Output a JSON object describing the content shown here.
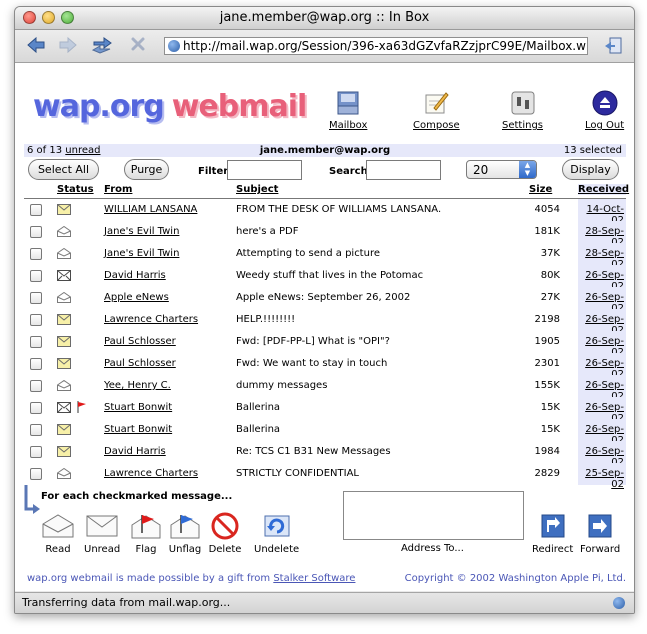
{
  "window": {
    "title": "jane.member@wap.org :: In Box"
  },
  "toolbar": {
    "url": "http://mail.wap.org/Session/396-xa63dGZvfaRZzjprC99E/Mailbox.w"
  },
  "brand": {
    "part1": "wap.org",
    "part2": "webmail"
  },
  "nav": [
    {
      "label": "Mailbox",
      "icon": "mailbox-icon"
    },
    {
      "label": "Compose",
      "icon": "compose-icon"
    },
    {
      "label": "Settings",
      "icon": "settings-icon"
    },
    {
      "label": "Log Out",
      "icon": "logout-icon"
    }
  ],
  "info": {
    "count_prefix": "6 of 13",
    "unread_link": "unread",
    "account": "jane.member@wap.org",
    "selected": "13 selected"
  },
  "controls": {
    "select_all": "Select All",
    "purge": "Purge",
    "filter_label": "Filter:",
    "search_label": "Search:",
    "page_size": "20",
    "display": "Display"
  },
  "columns": {
    "status": "Status",
    "from": "From",
    "subject": "Subject",
    "size": "Size",
    "received": "Received"
  },
  "messages": [
    {
      "status": "new",
      "flagged": false,
      "from": "WILLIAM LANSANA",
      "subject": "FROM THE DESK OF WILLIAMS LANSANA.",
      "size": "4054",
      "date": "14-Oct-02"
    },
    {
      "status": "read",
      "flagged": false,
      "from": "Jane's Evil Twin",
      "subject": "here's a PDF",
      "size": "181K",
      "date": "28-Sep-02"
    },
    {
      "status": "read",
      "flagged": false,
      "from": "Jane's Evil Twin",
      "subject": "Attempting to send a picture",
      "size": "37K",
      "date": "28-Sep-02"
    },
    {
      "status": "replied",
      "flagged": false,
      "from": "David Harris",
      "subject": "Weedy stuff that lives in the Potomac",
      "size": "80K",
      "date": "26-Sep-02"
    },
    {
      "status": "read",
      "flagged": false,
      "from": "Apple eNews",
      "subject": "Apple eNews: September 26, 2002",
      "size": "27K",
      "date": "26-Sep-02"
    },
    {
      "status": "new",
      "flagged": false,
      "from": "Lawrence Charters",
      "subject": "HELP.!!!!!!!!",
      "size": "2198",
      "date": "26-Sep-02"
    },
    {
      "status": "new",
      "flagged": false,
      "from": "Paul Schlosser",
      "subject": "Fwd: [PDF-PP-L] What is \"OPI\"?",
      "size": "1905",
      "date": "26-Sep-02"
    },
    {
      "status": "new",
      "flagged": false,
      "from": "Paul Schlosser",
      "subject": "Fwd: We want to stay in touch",
      "size": "2301",
      "date": "26-Sep-02"
    },
    {
      "status": "read",
      "flagged": false,
      "from": "Yee, Henry C.",
      "subject": "dummy messages",
      "size": "155K",
      "date": "26-Sep-02"
    },
    {
      "status": "replied",
      "flagged": true,
      "from": "Stuart Bonwit",
      "subject": "Ballerina",
      "size": "15K",
      "date": "26-Sep-02"
    },
    {
      "status": "new",
      "flagged": false,
      "from": "Stuart Bonwit",
      "subject": "Ballerina",
      "size": "15K",
      "date": "26-Sep-02"
    },
    {
      "status": "new",
      "flagged": false,
      "from": "David Harris",
      "subject": "Re: TCS C1 B31 New Messages",
      "size": "1984",
      "date": "26-Sep-02"
    },
    {
      "status": "read",
      "flagged": false,
      "from": "Lawrence Charters",
      "subject": "STRICTLY CONFIDENTIAL",
      "size": "2829",
      "date": "25-Sep-02"
    }
  ],
  "actions": {
    "caption": "For each checkmarked message...",
    "buttons": [
      {
        "label": "Read",
        "icon": "read-envelope-icon"
      },
      {
        "label": "Unread",
        "icon": "unread-envelope-icon"
      },
      {
        "label": "Flag",
        "icon": "flag-icon"
      },
      {
        "label": "Unflag",
        "icon": "unflag-icon"
      },
      {
        "label": "Delete",
        "icon": "delete-icon"
      },
      {
        "label": "Undelete",
        "icon": "undelete-icon"
      }
    ],
    "address_label": "Address To...",
    "redirect": "Redirect",
    "forward": "Forward"
  },
  "footer": {
    "left_prefix": "wap.org webmail is made possible by a gift from",
    "left_link": "Stalker Software",
    "right": "Copyright © 2002 Washington Apple Pi, Ltd."
  },
  "status_bar": {
    "text": "Transferring data from mail.wap.org..."
  },
  "colors": {
    "accent_bg": "#e6e8fa",
    "brand_blue": "#5566dd",
    "brand_pink": "#e8607a"
  }
}
